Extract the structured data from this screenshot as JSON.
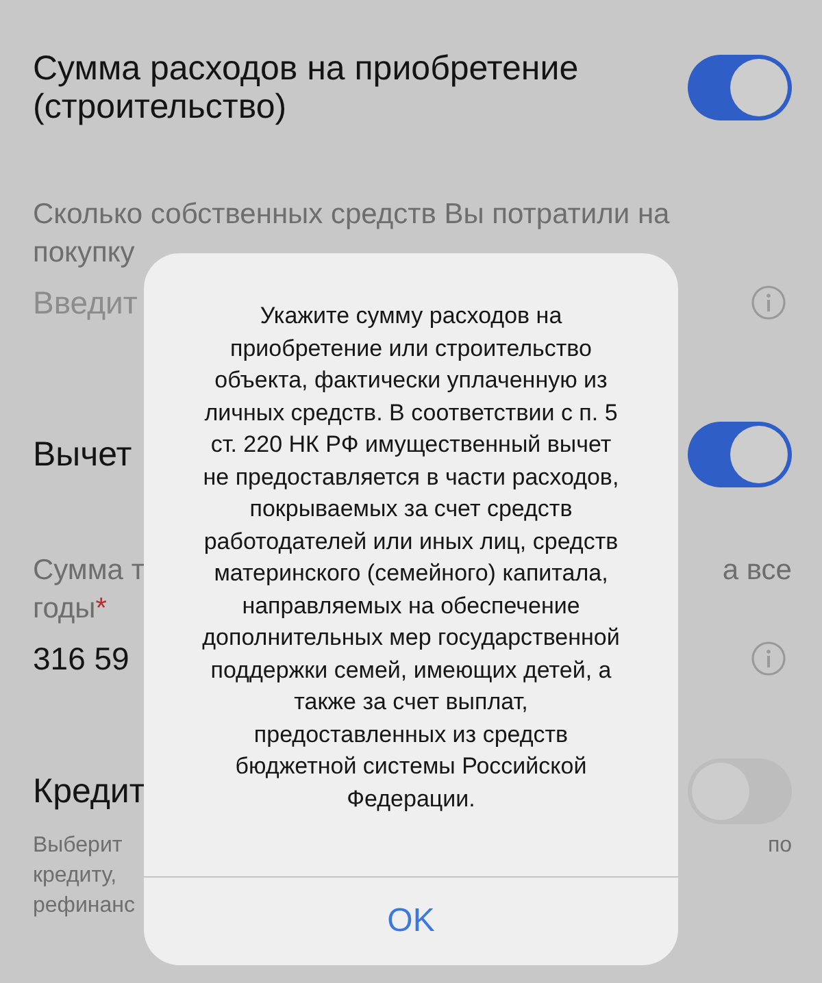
{
  "sections": [
    {
      "kind": "toggle",
      "lines": [
        {
          "left": "Сумма расходов на приобретение"
        },
        {
          "left": "(строительство)"
        }
      ],
      "on": true
    },
    {
      "kind": "field",
      "lines": [
        {
          "left": "Сколько собственных средств Вы потратили на"
        },
        {
          "left": "покупку"
        }
      ],
      "placeholder": "Введит"
    },
    {
      "kind": "toggle",
      "lines": [
        {
          "left": "Вычет"
        }
      ],
      "on": true
    },
    {
      "kind": "field",
      "lines": [
        {
          "left": "Сумма т",
          "right": "а все"
        },
        {
          "left": "годы",
          "asterisk": "*"
        }
      ],
      "value": "316 59"
    },
    {
      "kind": "toggle",
      "lines": [
        {
          "left": "Кредит"
        }
      ],
      "on": false,
      "description": [
        {
          "left": "Выберит",
          "right": "по"
        },
        {
          "left": "кредиту,"
        },
        {
          "left": "рефинанс"
        }
      ]
    }
  ],
  "dialog": {
    "message": "Укажите сумму расходов на приобретение или строительство объекта, фактически уплаченную из личных средств. В соответствии с п. 5 ст. 220 НК РФ имущественный вычет не предоставляется в части расходов, покрываемых за счет средств работодателей или иных лиц, средств материнского (семейного) капитала, направляемых на обеспечение дополнительных мер государственной поддержки семей, имеющих детей, а также за счет выплат, предоставленных из средств бюджетной системы Российской Федерации.",
    "button": "OK"
  }
}
